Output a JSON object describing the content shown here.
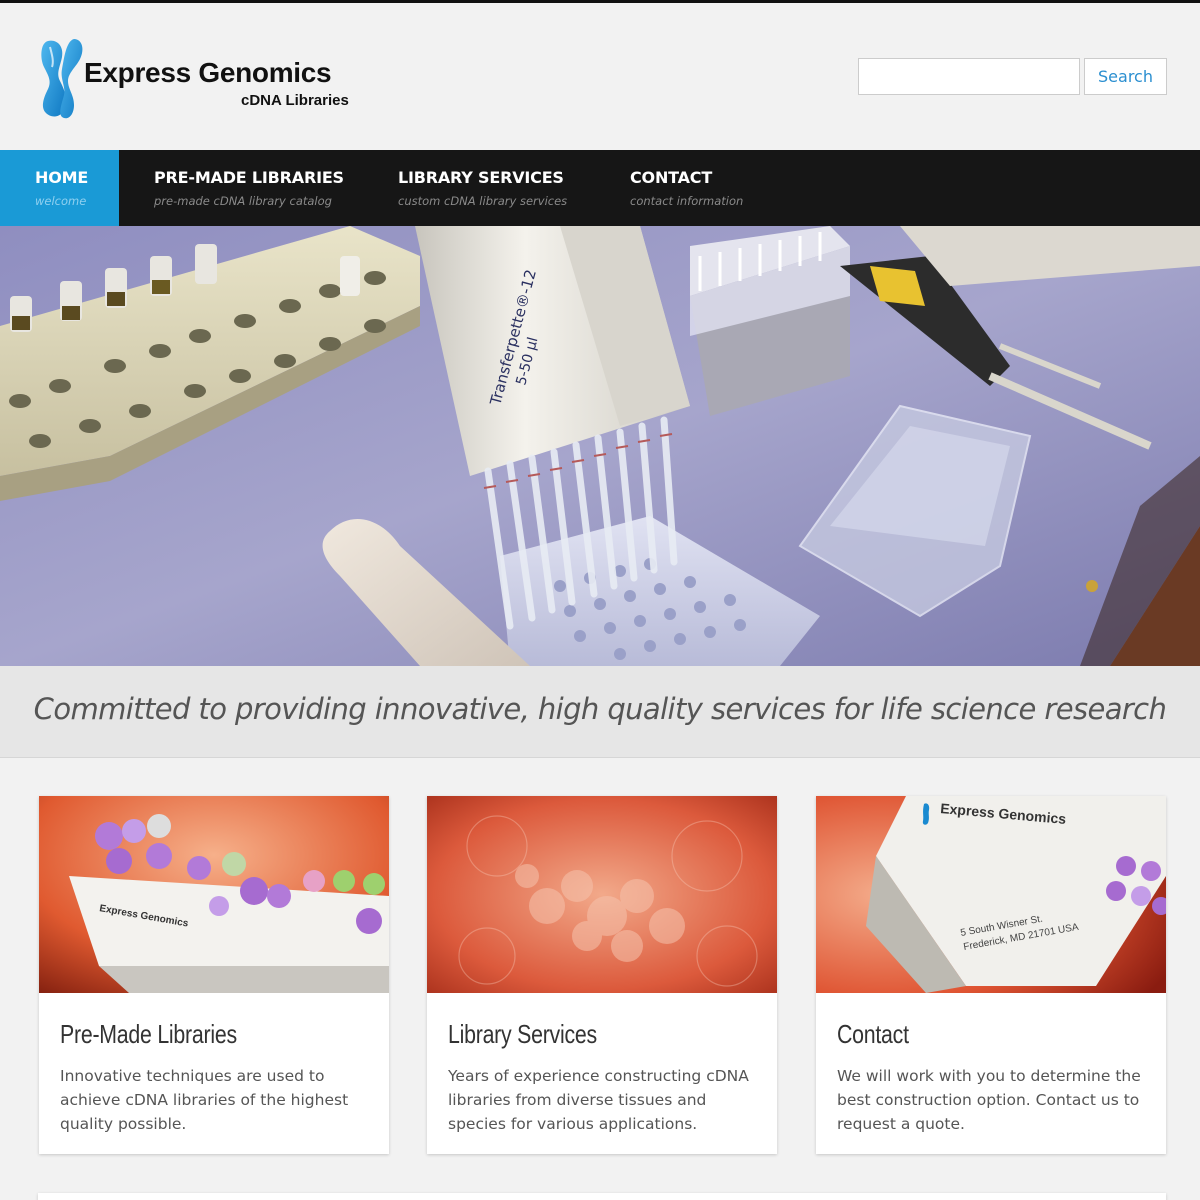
{
  "header": {
    "logo_title": "Express Genomics",
    "logo_subtitle": "cDNA Libraries",
    "search_placeholder": "",
    "search_button": "Search"
  },
  "nav": {
    "items": [
      {
        "label": "HOME",
        "desc": "welcome",
        "active": true
      },
      {
        "label": "PRE-MADE LIBRARIES",
        "desc": "pre-made cDNA library catalog",
        "active": false
      },
      {
        "label": "LIBRARY SERVICES",
        "desc": "custom cDNA library services",
        "active": false
      },
      {
        "label": "CONTACT",
        "desc": "contact information",
        "active": false
      }
    ]
  },
  "hero": {
    "pipette_text_1": "Transferpette®-12",
    "pipette_text_2": "5-50 µl"
  },
  "tagline": "Committed to providing innovative, high quality services for life science research",
  "cards": [
    {
      "title": "Pre-Made Libraries",
      "text": "Innovative techniques are used to achieve cDNA libraries of the highest quality possible.",
      "image_label": "Express Genomics"
    },
    {
      "title": "Library Services",
      "text": "Years of experience constructing cDNA libraries from diverse tissues and species for various applications."
    },
    {
      "title": "Contact",
      "text": "We will work with you to determine the best construction option. Contact us to request a quote.",
      "image_label": "Express Genomics",
      "box_address_1": "5 South Wisner St.",
      "box_address_2": "Frederick, MD 21701 USA"
    }
  ],
  "colors": {
    "accent": "#1a9ad6",
    "nav_bg": "#161616",
    "search_text": "#2b8fd0"
  }
}
